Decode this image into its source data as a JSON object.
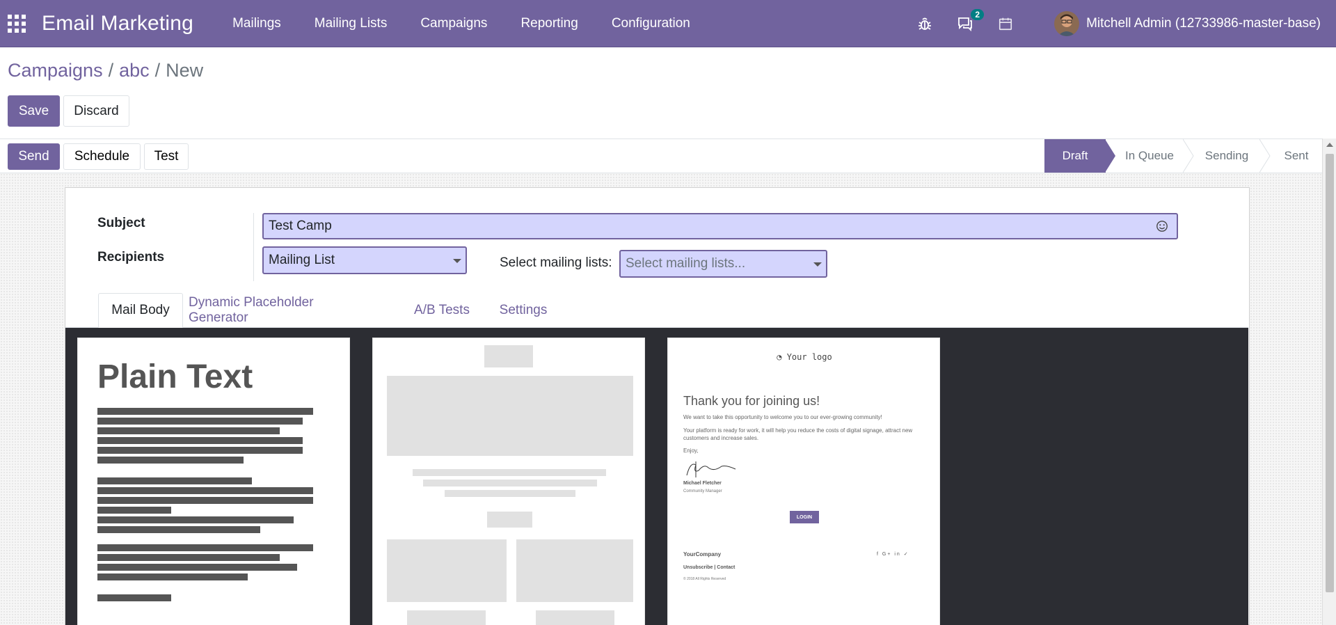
{
  "navbar": {
    "app_title": "Email Marketing",
    "menu": [
      "Mailings",
      "Mailing Lists",
      "Campaigns",
      "Reporting",
      "Configuration"
    ],
    "message_count": "2",
    "user": "Mitchell Admin (12733986-master-base)",
    "icons": [
      "apps-grid-icon",
      "bug-icon",
      "chat-icon",
      "calendar-icon"
    ]
  },
  "breadcrumb": {
    "root": "Campaigns",
    "parent": "abc",
    "current": "New",
    "separator": "/"
  },
  "actions": {
    "save": "Save",
    "discard": "Discard"
  },
  "statusbar": {
    "send": "Send",
    "schedule": "Schedule",
    "test": "Test",
    "stages": [
      "Draft",
      "In Queue",
      "Sending",
      "Sent"
    ],
    "active_stage": "Draft"
  },
  "form": {
    "subject_label": "Subject",
    "subject_value": "Test Camp",
    "recipients_label": "Recipients",
    "recipients_value": "Mailing List",
    "mailing_lists_label": "Select mailing lists:",
    "mailing_lists_placeholder": "Select mailing lists..."
  },
  "tabs": [
    "Mail Body",
    "Dynamic Placeholder Generator",
    "A/B Tests",
    "Settings"
  ],
  "templates": {
    "plain_title": "Plain Text",
    "welcome": {
      "logo": "Your logo",
      "heading": "Thank you for joining us!",
      "p1": "We want to take this opportunity to welcome you to our ever-growing community!",
      "p2": "Your platform is ready for work, it will help you reduce the costs of digital signage, attract new customers and increase sales.",
      "enjoy": "Enjoy,",
      "signer": "Michael Fletcher",
      "role": "Community Manager",
      "button": "LOGIN",
      "company": "YourCompany",
      "unsubscribe": "Unsubscribe",
      "contact": "Contact",
      "copyright": "© 2018 All Rights Reserved",
      "social": "f G+ in ✓"
    }
  },
  "colors": {
    "brand": "#71639e",
    "field_bg": "#d4d5fd",
    "badge": "#017e84",
    "editor_bg": "#2c2d33"
  }
}
